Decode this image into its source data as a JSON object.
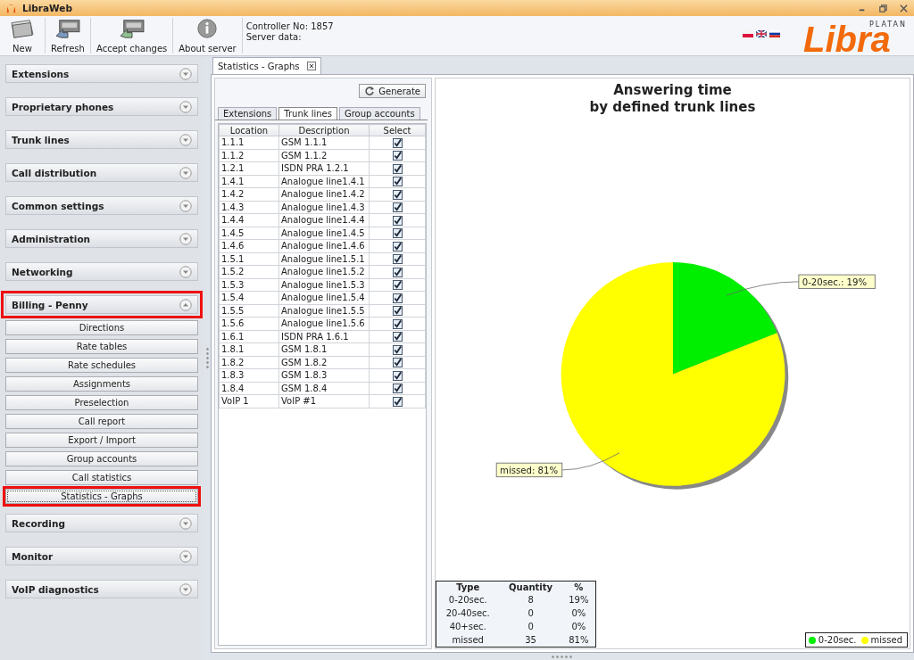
{
  "window": {
    "title": "LibraWeb"
  },
  "toolbar": [
    {
      "label": "New",
      "kind": "new"
    },
    {
      "label": "Refresh",
      "kind": "refresh"
    },
    {
      "label": "Accept changes",
      "kind": "accept"
    },
    {
      "label": "About server",
      "kind": "about"
    }
  ],
  "server_info": [
    "Controller No: 1857",
    "Server data:"
  ],
  "languages": [
    {
      "kind": "pl"
    },
    {
      "kind": "gb"
    },
    {
      "kind": "ru"
    }
  ],
  "logo": {
    "brand": "PLATAN",
    "name": "Libra"
  },
  "sidebar": [
    {
      "label": "Extensions",
      "expanded": false,
      "highlighted": false
    },
    {
      "label": "Proprietary phones",
      "expanded": false,
      "highlighted": false
    },
    {
      "label": "Trunk lines",
      "expanded": false,
      "highlighted": false
    },
    {
      "label": "Call distribution",
      "expanded": false,
      "highlighted": false
    },
    {
      "label": "Common settings",
      "expanded": false,
      "highlighted": false
    },
    {
      "label": "Administration",
      "expanded": false,
      "highlighted": false
    },
    {
      "label": "Networking",
      "expanded": false,
      "highlighted": false
    },
    {
      "label": "Billing - Penny",
      "expanded": true,
      "highlighted": true,
      "items": [
        {
          "label": "Directions",
          "selected": false,
          "highlighted": false
        },
        {
          "label": "Rate tables",
          "selected": false,
          "highlighted": false
        },
        {
          "label": "Rate schedules",
          "selected": false,
          "highlighted": false
        },
        {
          "label": "Assignments",
          "selected": false,
          "highlighted": false
        },
        {
          "label": "Preselection",
          "selected": false,
          "highlighted": false
        },
        {
          "label": "Call report",
          "selected": false,
          "highlighted": false
        },
        {
          "label": "Export / Import",
          "selected": false,
          "highlighted": false
        },
        {
          "label": "Group accounts",
          "selected": false,
          "highlighted": false
        },
        {
          "label": "Call statistics",
          "selected": false,
          "highlighted": false
        },
        {
          "label": "Statistics - Graphs",
          "selected": true,
          "highlighted": true
        }
      ]
    },
    {
      "label": "Recording",
      "expanded": false,
      "highlighted": false
    },
    {
      "label": "Monitor",
      "expanded": false,
      "highlighted": false
    },
    {
      "label": "VoIP diagnostics",
      "expanded": false,
      "highlighted": false
    }
  ],
  "document_tab": {
    "title": "Statistics - Graphs"
  },
  "generate_button": "Generate",
  "tabs": [
    {
      "label": "Extensions",
      "selected": false
    },
    {
      "label": "Trunk lines",
      "selected": true
    },
    {
      "label": "Group accounts",
      "selected": false
    }
  ],
  "table": {
    "columns": [
      "Location",
      "Description",
      "Select"
    ],
    "rows": [
      {
        "location": "1.1.1",
        "description": "GSM 1.1.1",
        "checked": true
      },
      {
        "location": "1.1.2",
        "description": "GSM 1.1.2",
        "checked": true
      },
      {
        "location": "1.2.1",
        "description": "ISDN PRA 1.2.1",
        "checked": true
      },
      {
        "location": "1.4.1",
        "description": "Analogue line1.4.1",
        "checked": true
      },
      {
        "location": "1.4.2",
        "description": "Analogue line1.4.2",
        "checked": true
      },
      {
        "location": "1.4.3",
        "description": "Analogue line1.4.3",
        "checked": true
      },
      {
        "location": "1.4.4",
        "description": "Analogue line1.4.4",
        "checked": true
      },
      {
        "location": "1.4.5",
        "description": "Analogue line1.4.5",
        "checked": true
      },
      {
        "location": "1.4.6",
        "description": "Analogue line1.4.6",
        "checked": true
      },
      {
        "location": "1.5.1",
        "description": "Analogue line1.5.1",
        "checked": true
      },
      {
        "location": "1.5.2",
        "description": "Analogue line1.5.2",
        "checked": true
      },
      {
        "location": "1.5.3",
        "description": "Analogue line1.5.3",
        "checked": true
      },
      {
        "location": "1.5.4",
        "description": "Analogue line1.5.4",
        "checked": true
      },
      {
        "location": "1.5.5",
        "description": "Analogue line1.5.5",
        "checked": true
      },
      {
        "location": "1.5.6",
        "description": "Analogue line1.5.6",
        "checked": true
      },
      {
        "location": "1.6.1",
        "description": "ISDN PRA 1.6.1",
        "checked": true
      },
      {
        "location": "1.8.1",
        "description": "GSM 1.8.1",
        "checked": true
      },
      {
        "location": "1.8.2",
        "description": "GSM 1.8.2",
        "checked": true
      },
      {
        "location": "1.8.3",
        "description": "GSM 1.8.3",
        "checked": true
      },
      {
        "location": "1.8.4",
        "description": "GSM 1.8.4",
        "checked": true
      },
      {
        "location": "VoIP 1",
        "description": "VoIP #1",
        "checked": true
      }
    ]
  },
  "chart": {
    "chart_data": {
      "type": "pie",
      "title": "Answering time\nby defined trunk lines",
      "categories": [
        "0-20sec.",
        "missed"
      ],
      "values": [
        19,
        81
      ],
      "value_labels": [
        "0-20sec.: 19%",
        "missed: 81%"
      ]
    },
    "summary": {
      "columns": [
        "Type",
        "Quantity",
        "%"
      ],
      "rows": [
        [
          "0-20sec.",
          "8",
          "19%"
        ],
        [
          "20-40sec.",
          "0",
          "0%"
        ],
        [
          "40+sec.",
          "0",
          "0%"
        ],
        [
          "missed",
          "35",
          "81%"
        ]
      ]
    },
    "legend": [
      {
        "color": "#00ee00"
      },
      {
        "color": "#ffff00"
      }
    ]
  }
}
